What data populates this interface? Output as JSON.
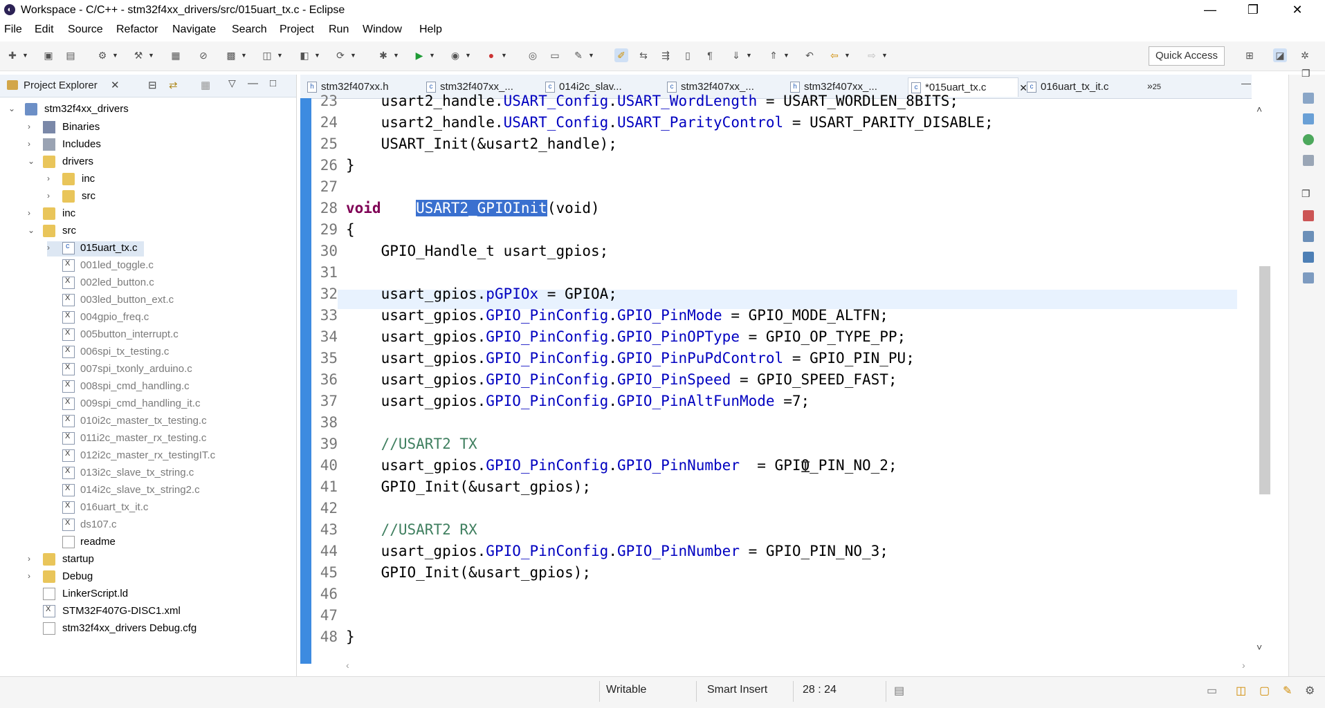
{
  "window": {
    "title": "Workspace - C/C++ - stm32f4xx_drivers/src/015uart_tx.c - Eclipse",
    "minimize": "—",
    "restore": "❐",
    "close": "✕"
  },
  "menu": [
    "File",
    "Edit",
    "Source",
    "Refactor",
    "Navigate",
    "Search",
    "Project",
    "Run",
    "Window",
    "Help"
  ],
  "toolbar": {
    "quick_access": "Quick Access"
  },
  "project_explorer": {
    "title": "Project Explorer",
    "tree": [
      {
        "label": "stm32f4xx_drivers",
        "icon": "project-icon"
      },
      {
        "label": "Binaries",
        "icon": "binaries-icon"
      },
      {
        "label": "Includes",
        "icon": "includes-icon"
      },
      {
        "label": "drivers",
        "icon": "folder-icon"
      },
      {
        "label": "inc",
        "icon": "folder-icon"
      },
      {
        "label": "src",
        "icon": "folder-icon"
      },
      {
        "label": "inc",
        "icon": "folder-icon"
      },
      {
        "label": "src",
        "icon": "folder-icon"
      },
      {
        "label": "015uart_tx.c",
        "icon": "c-file-icon"
      },
      {
        "label": "001led_toggle.c",
        "icon": "excluded-c-file-icon"
      },
      {
        "label": "002led_button.c",
        "icon": "excluded-c-file-icon"
      },
      {
        "label": "003led_button_ext.c",
        "icon": "excluded-c-file-icon"
      },
      {
        "label": "004gpio_freq.c",
        "icon": "excluded-c-file-icon"
      },
      {
        "label": "005button_interrupt.c",
        "icon": "excluded-c-file-icon"
      },
      {
        "label": "006spi_tx_testing.c",
        "icon": "excluded-c-file-icon"
      },
      {
        "label": "007spi_txonly_arduino.c",
        "icon": "excluded-c-file-icon"
      },
      {
        "label": "008spi_cmd_handling.c",
        "icon": "excluded-c-file-icon"
      },
      {
        "label": "009spi_cmd_handling_it.c",
        "icon": "excluded-c-file-icon"
      },
      {
        "label": "010i2c_master_tx_testing.c",
        "icon": "excluded-c-file-icon"
      },
      {
        "label": "011i2c_master_rx_testing.c",
        "icon": "excluded-c-file-icon"
      },
      {
        "label": "012i2c_master_rx_testingIT.c",
        "icon": "excluded-c-file-icon"
      },
      {
        "label": "013i2c_slave_tx_string.c",
        "icon": "excluded-c-file-icon"
      },
      {
        "label": "014i2c_slave_tx_string2.c",
        "icon": "excluded-c-file-icon"
      },
      {
        "label": "016uart_tx_it.c",
        "icon": "excluded-c-file-icon"
      },
      {
        "label": "ds107.c",
        "icon": "excluded-c-file-icon"
      },
      {
        "label": "readme",
        "icon": "text-file-icon"
      },
      {
        "label": "startup",
        "icon": "folder-icon"
      },
      {
        "label": "Debug",
        "icon": "folder-icon"
      },
      {
        "label": "LinkerScript.ld",
        "icon": "text-file-icon"
      },
      {
        "label": "STM32F407G-DISC1.xml",
        "icon": "xml-file-icon"
      },
      {
        "label": "stm32f4xx_drivers Debug.cfg",
        "icon": "text-file-icon"
      }
    ]
  },
  "editor": {
    "tabs": [
      {
        "label": "stm32f407xx.h",
        "icon": "h"
      },
      {
        "label": "stm32f407xx_...",
        "icon": "c"
      },
      {
        "label": "014i2c_slav...",
        "icon": "c"
      },
      {
        "label": "stm32f407xx_...",
        "icon": "c"
      },
      {
        "label": "stm32f407xx_...",
        "icon": "h"
      },
      {
        "label": "*015uart_tx.c",
        "icon": "c"
      },
      {
        "label": "016uart_tx_it.c",
        "icon": "c"
      }
    ],
    "overflow_count": "25",
    "line_numbers": [
      "23",
      "24",
      "25",
      "26",
      "27",
      "28",
      "29",
      "30",
      "31",
      "32",
      "33",
      "34",
      "35",
      "36",
      "37",
      "38",
      "39",
      "40",
      "41",
      "42",
      "43",
      "44",
      "45",
      "46",
      "47",
      "48"
    ],
    "code": {
      "l23_a": "    usart2_handle.",
      "l23_b": "USART_Config",
      "l23_c": ".",
      "l23_d": "USART_WordLength",
      "l23_e": " = USART_WORDLEN_8BITS;",
      "l24_a": "    usart2_handle.",
      "l24_b": "USART_Config",
      "l24_c": ".",
      "l24_d": "USART_ParityControl",
      "l24_e": " = USART_PARITY_DISABLE;",
      "l25": "    USART_Init(&usart2_handle);",
      "l26": "}",
      "l28_kw": "void",
      "l28_gap": "    ",
      "l28_sel": "USART2_GPIOInit",
      "l28_rest": "(void)",
      "l29": "{",
      "l30_type": "GPIO_Handle_t",
      "l30_rest": " usart_gpios;",
      "l32_a": "    usart_gpios.",
      "l32_b": "pGPIOx",
      "l32_c": " = GPIOA;",
      "l33_b": "GPIO_PinConfig",
      "l33_d": "GPIO_PinMode",
      "l33_e": " = GPIO_MODE_ALTFN;",
      "l34_d": "GPIO_PinOPType",
      "l34_e": " = GPIO_OP_TYPE_PP;",
      "l35_d": "GPIO_PinPuPdControl",
      "l35_e": " = GPIO_PIN_PU;",
      "l36_d": "GPIO_PinSpeed",
      "l36_e": " = GPIO_SPEED_FAST;",
      "l37_d": "GPIO_PinAltFunMode",
      "l37_e": " =7;",
      "l39": "//USART2 TX",
      "l40_d": "GPIO_PinNumber",
      "l40_e": "  = GPIO_PIN_NO_2;",
      "l41": "    GPIO_Init(&usart_gpios);",
      "l43": "//USART2 RX",
      "l44_d": "GPIO_PinNumber",
      "l44_e": " = GPIO_PIN_NO_3;",
      "l45": "    GPIO_Init(&usart_gpios);",
      "l48": "}",
      "prefix": "    usart_gpios.",
      "dot": "."
    }
  },
  "status": {
    "writable": "Writable",
    "insert_mode": "Smart Insert",
    "position": "28 : 24"
  },
  "colors": {
    "keyword": "#7f0055",
    "field": "#0000c0",
    "comment": "#3f7f5f",
    "selection": "#3a70cf",
    "ruler": "#3d8be0"
  }
}
